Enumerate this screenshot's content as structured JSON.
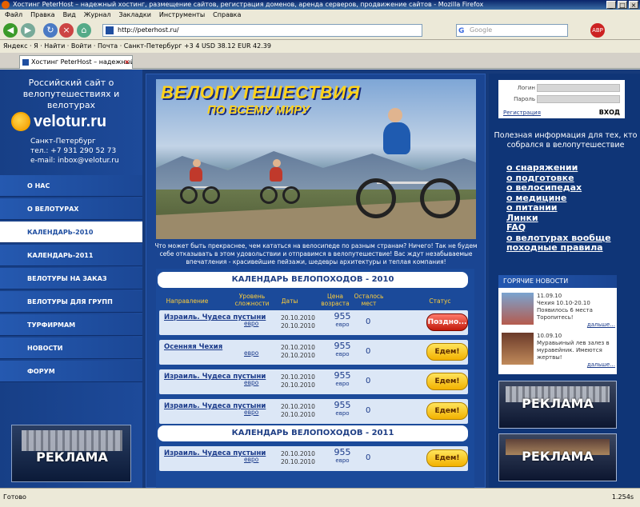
{
  "browser": {
    "title": "Хостинг PeterHost – надежный хостинг, размещение сайтов, регистрация доменов, аренда серверов, продвижение сайтов - Mozilla Firefox",
    "menu": [
      "Файл",
      "Правка",
      "Вид",
      "Журнал",
      "Закладки",
      "Инструменты",
      "Справка"
    ],
    "url": "http://peterhost.ru/",
    "search_placeholder": "Google",
    "toolbar_text": "Яндекс · Я ·  Найти  ·  Войти  ·  Почта  ·  Санкт-Петербург  +3  4  USD 38.12  EUR 42.39",
    "tab_label": "Хостинг PeterHost – надежный х...",
    "status_left": "Готово",
    "status_right": "1.254s"
  },
  "left": {
    "head": "Российский сайт о велопутешествиях и велотурах",
    "logo": "velotur.ru",
    "city": "Санкт-Петербург",
    "phone": "тел.: +7 931 290 52 73",
    "email": "e-mail: inbox@velotur.ru",
    "menu": [
      {
        "label": "О НАС"
      },
      {
        "label": "О ВЕЛОТУРАХ"
      },
      {
        "label": "КАЛЕНДАРЬ-2010"
      },
      {
        "label": "КАЛЕНДАРЬ-2011"
      },
      {
        "label": "ВЕЛОТУРЫ НА ЗАКАЗ"
      },
      {
        "label": "ВЕЛОТУРЫ ДЛЯ ГРУПП"
      },
      {
        "label": "ТУРФИРМАМ"
      },
      {
        "label": "НОВОСТИ"
      },
      {
        "label": "ФОРУМ"
      }
    ],
    "active_index": 2,
    "ad_text": "РЕКЛАМА"
  },
  "banner": {
    "title1": "ВЕЛОПУТЕШЕСТВИЯ",
    "title2": "ПО ВСЕМУ МИРУ",
    "caption": "Что может быть прекраснее, чем кататься на велосипеде по разным странам? Ничего! Так не будем себе отказывать в этом удовольствии и отправимся в велопутешествие! Вас ждут незабываемые впечатления - красивейшие пейзажи, шедевры архитектуры и теплая компания!"
  },
  "calendar": {
    "title2010": "КАЛЕНДАРЬ ВЕЛОПОХОДОВ  - 2010",
    "title2011": "КАЛЕНДАРЬ ВЕЛОПОХОДОВ  - 2011",
    "headers": {
      "direction": "Направление",
      "level": "Уровень сложности",
      "dates": "Даты",
      "price": "Цена возраста",
      "places": "Осталось мест",
      "status": "Статус"
    },
    "rows2010": [
      {
        "dir": "Израиль. Чудеса пустыни",
        "cur": "евро",
        "d1": "20.10.2010",
        "d2": "20.10.2010",
        "price": "955",
        "unit": "евро",
        "places": "0",
        "status": "Поздно...",
        "kind": "late"
      },
      {
        "dir": "Осенняя Чехия",
        "cur": "евро",
        "d1": "20.10.2010",
        "d2": "20.10.2010",
        "price": "955",
        "unit": "евро",
        "places": "0",
        "status": "Едем!",
        "kind": "go"
      },
      {
        "dir": "Израиль. Чудеса пустыни",
        "cur": "евро",
        "d1": "20.10.2010",
        "d2": "20.10.2010",
        "price": "955",
        "unit": "евро",
        "places": "0",
        "status": "Едем!",
        "kind": "go"
      },
      {
        "dir": "Израиль. Чудеса пустыни",
        "cur": "евро",
        "d1": "20.10.2010",
        "d2": "20.10.2010",
        "price": "955",
        "unit": "евро",
        "places": "0",
        "status": "Едем!",
        "kind": "go"
      }
    ],
    "rows2011": [
      {
        "dir": "Израиль. Чудеса пустыни",
        "cur": "евро",
        "d1": "20.10.2010",
        "d2": "20.10.2010",
        "price": "955",
        "unit": "евро",
        "places": "0",
        "status": "Едем!",
        "kind": "go"
      }
    ]
  },
  "right": {
    "login_label": "Логин",
    "password_label": "Пароль",
    "register": "Регистрация",
    "enter": "ВХОД",
    "info_head": "Полезная информация для тех, кто собрался в велопутешествие",
    "links": [
      "о снаряжении",
      "о подготовке",
      "о велосипедах",
      "о медицине",
      "о питании",
      "Линки",
      "FAQ",
      "о велотурах вообще",
      "походные правила"
    ],
    "news_head": "ГОРЯЧИЕ НОВОСТИ",
    "news": [
      {
        "date": "11.09.10",
        "text": "Чехия 10.10-20.10 Появилось 6 места Торопитесь!",
        "more": "дальше..."
      },
      {
        "date": "10.09.10",
        "text": "Муравьиный лев залез в муравейник. Имеются жертвы!",
        "more": "дальше..."
      }
    ],
    "ad_text": "РЕКЛАМА"
  }
}
